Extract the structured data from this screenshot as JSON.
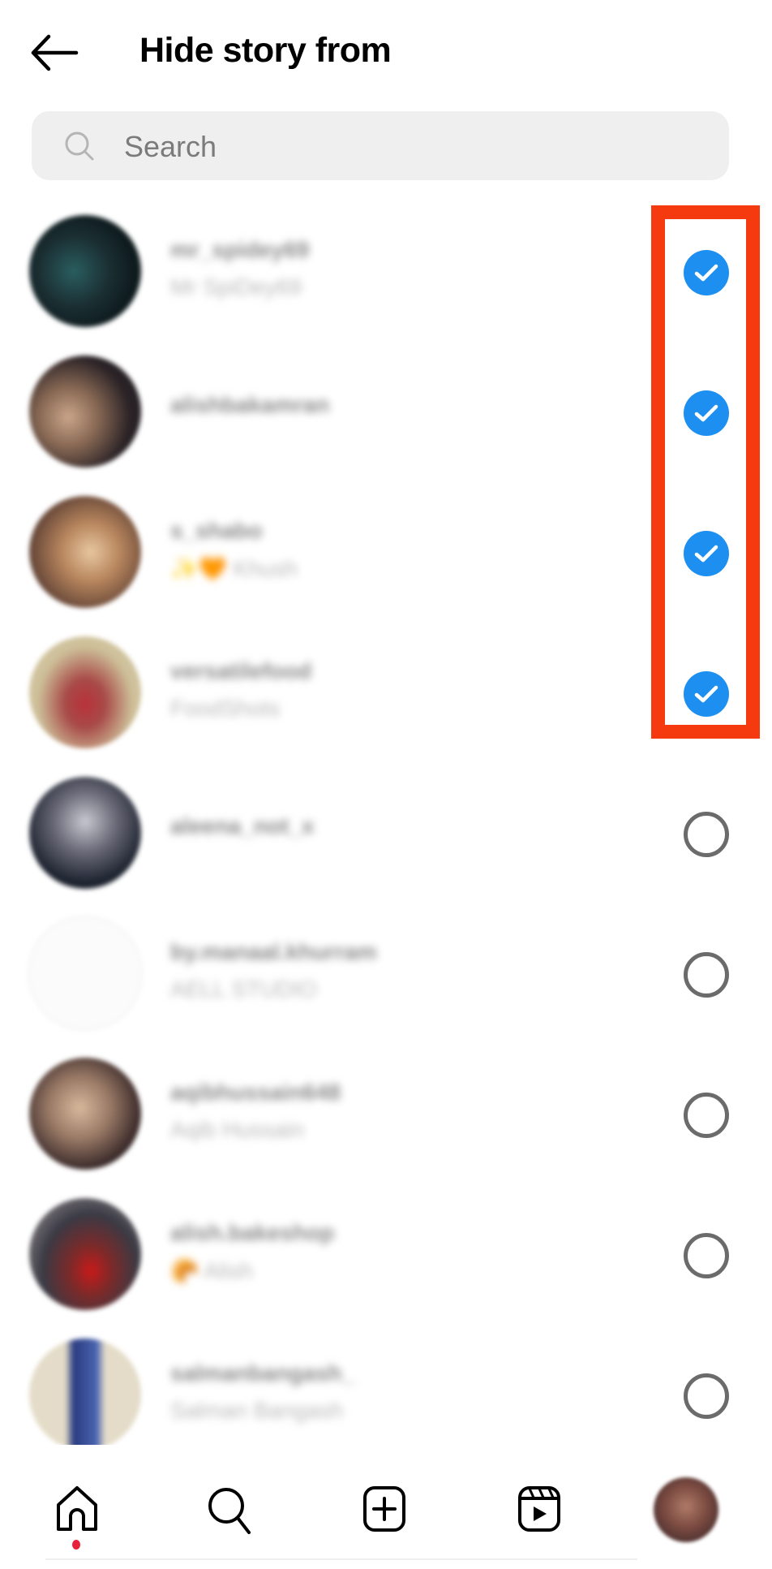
{
  "header": {
    "back_icon": "arrow-left-icon",
    "title": "Hide story from"
  },
  "search": {
    "icon": "search-icon",
    "placeholder": "Search",
    "value": ""
  },
  "accent_colors": {
    "checked": "#1d8ff0",
    "highlight_box": "#f53a10",
    "notification_dot": "#e8203b"
  },
  "users": [
    {
      "username": "mr_spidey69",
      "full_name": "Mr SpiDey69",
      "selected": true
    },
    {
      "username": "alishbakamran",
      "full_name": "",
      "selected": true
    },
    {
      "username": "s_shabo",
      "full_name": "✨🧡 Khush",
      "selected": true
    },
    {
      "username": "versatilefood",
      "full_name": "FoodShots",
      "selected": true
    },
    {
      "username": "aleena_not_x",
      "full_name": "",
      "selected": false
    },
    {
      "username": "by.manaal.khurram",
      "full_name": "AELL STUDIO",
      "selected": false
    },
    {
      "username": "aqibhussain648",
      "full_name": "Aqib Hussain",
      "selected": false
    },
    {
      "username": "alish.bakeshop",
      "full_name": "🥐 Alish",
      "selected": false
    },
    {
      "username": "salmanbangash_",
      "full_name": "Salman Bangash",
      "selected": false
    }
  ],
  "bottom_nav": [
    {
      "name": "home",
      "icon": "home-icon",
      "active": true,
      "has_notification": true
    },
    {
      "name": "search",
      "icon": "search-icon"
    },
    {
      "name": "create",
      "icon": "plus-square-icon"
    },
    {
      "name": "reels",
      "icon": "reels-icon"
    },
    {
      "name": "profile",
      "icon": "profile-avatar"
    }
  ]
}
